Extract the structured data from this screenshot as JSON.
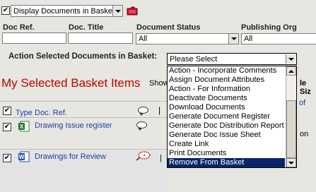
{
  "toolbar": {
    "view_select": "Display Documents in Basket"
  },
  "filters": {
    "doc_ref": {
      "label": "Doc Ref.",
      "value": ""
    },
    "doc_title": {
      "label": "Doc. Title",
      "value": ""
    },
    "doc_status": {
      "label": "Document Status",
      "value": "All"
    },
    "publishing_org": {
      "label": "Publishing Org",
      "value": "All"
    }
  },
  "heading": "My Selected Basket Items",
  "show_partial": "Show",
  "size_partial": "le Siz",
  "of_partial": "of",
  "action": {
    "label": "Action Selected Documents in Basket:",
    "selected": "Please Select",
    "options": [
      "Action - Incorporate Comments",
      "Assign Document Attributes",
      "Action - For Information",
      "Deactivate Documents",
      "Download Documents",
      "Generate Document Register",
      "Generate Doc Distribution Report",
      "Generate Doc Issue Sheet",
      "Create Link",
      "Print Documents",
      "Remove From Basket"
    ],
    "highlighted": "Remove From Basket"
  },
  "table": {
    "columns": {
      "type": "Type",
      "doc_ref": "Doc. Ref."
    },
    "rows": [
      {
        "title": "Drawing Issue register",
        "icon": "excel-file-icon",
        "partial": "on"
      },
      {
        "title": "Drawings for Review",
        "icon": "word-file-icon",
        "partial": ""
      }
    ]
  },
  "colors": {
    "heading": "#c00000",
    "link": "#1a3fa8",
    "highlight": "#0a246a"
  }
}
